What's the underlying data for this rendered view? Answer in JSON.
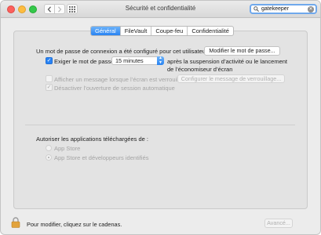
{
  "window": {
    "title": "Sécurité et confidentialité"
  },
  "search": {
    "value": "gatekeeper"
  },
  "tabs": [
    {
      "label": "Général",
      "active": true
    },
    {
      "label": "FileVault",
      "active": false
    },
    {
      "label": "Coupe-feu",
      "active": false
    },
    {
      "label": "Confidentialité",
      "active": false
    }
  ],
  "general": {
    "password_text": "Un mot de passe de connexion a été configuré pour cet utilisateur",
    "change_password_button": "Modifier le mot de passe...",
    "require_password_label": "Exiger le mot de passe",
    "require_password_checked": true,
    "require_password_delay": "15 minutes",
    "require_password_after_line1": "après la suspension d’activité ou le lancement",
    "require_password_after_line2": "de l’économiseur d’écran",
    "show_message_label": "Afficher un message lorsque l’écran est verrouillé",
    "show_message_checked": false,
    "lock_message_button": "Configurer le message de verrouillage...",
    "disable_autologin_label": "Désactiver l’ouverture de session automatique",
    "disable_autologin_checked": true
  },
  "downloads": {
    "heading": "Autoriser les applications téléchargées de :",
    "options": [
      {
        "label": "App Store",
        "selected": false
      },
      {
        "label": "App Store et développeurs identifiés",
        "selected": true
      }
    ]
  },
  "footer": {
    "lock_text": "Pour modifier, cliquez sur le cadenas.",
    "advanced_button": "Avancé..."
  },
  "colors": {
    "accent": "#2a84f4",
    "search_ring": "#6fa8ec",
    "lock_gold": "#e2a33c"
  }
}
